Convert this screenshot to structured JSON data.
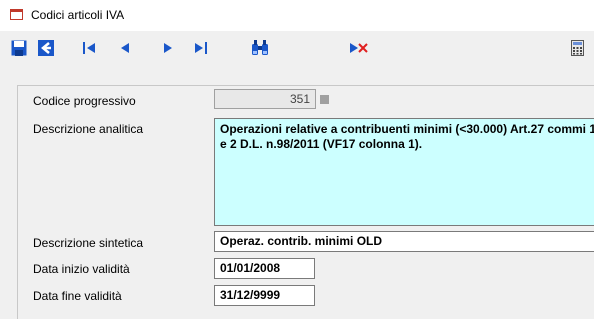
{
  "window": {
    "title": "Codici articoli IVA"
  },
  "toolbar": {
    "icons": [
      "save-icon",
      "back-icon",
      "first-record-icon",
      "prev-record-icon",
      "next-record-icon",
      "last-record-icon",
      "search-binoculars-icon",
      "delete-record-icon",
      "calculator-icon"
    ],
    "accent": "#1a57c9",
    "delete_color": "#e02020"
  },
  "form": {
    "codice_progressivo": {
      "label": "Codice progressivo",
      "value": "351"
    },
    "descrizione_analitica": {
      "label": "Descrizione analitica",
      "value": "Operazioni relative a contribuenti minimi (<30.000) Art.27 commi 1 e 2 D.L. n.98/2011 (VF17 colonna 1)."
    },
    "descrizione_sintetica": {
      "label": "Descrizione sintetica",
      "value": "Operaz. contrib. minimi OLD"
    },
    "data_inizio": {
      "label": "Data inizio validità",
      "value": "01/01/2008"
    },
    "data_fine": {
      "label": "Data fine validità",
      "value": "31/12/9999"
    }
  }
}
